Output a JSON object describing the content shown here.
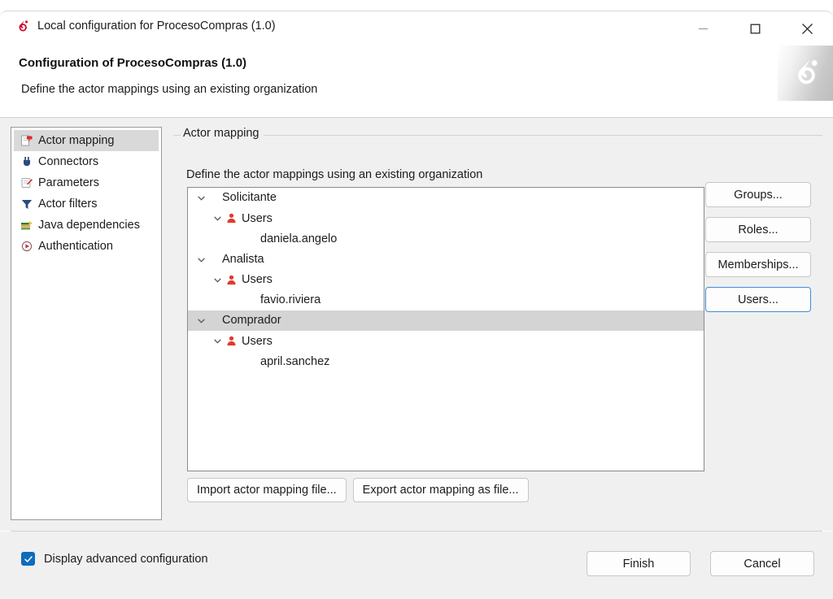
{
  "window": {
    "title": "Local configuration for ProcesoCompras (1.0)",
    "app_icon": "bonita-logo-icon",
    "controls": {
      "minimize": "minimize-icon",
      "maximize": "maximize-icon",
      "close": "close-icon"
    }
  },
  "header": {
    "title": "Configuration of ProcesoCompras (1.0)",
    "description": "Define the actor mappings using an existing organization",
    "watermark_icon": "bonita-logo-watermark"
  },
  "sidebar": {
    "items": [
      {
        "label": "Actor mapping",
        "icon": "actor-mapping-icon",
        "selected": true
      },
      {
        "label": "Connectors",
        "icon": "connector-plug-icon",
        "selected": false
      },
      {
        "label": "Parameters",
        "icon": "parameters-icon",
        "selected": false
      },
      {
        "label": "Actor filters",
        "icon": "filter-funnel-icon",
        "selected": false
      },
      {
        "label": "Java dependencies",
        "icon": "java-books-icon",
        "selected": false
      },
      {
        "label": "Authentication",
        "icon": "authentication-icon",
        "selected": false
      }
    ]
  },
  "main": {
    "group_legend": "Actor mapping",
    "description": "Define the actor mappings using an existing organization",
    "tree": [
      {
        "label": "Solicitante",
        "level": 0,
        "expanded": true,
        "icon": null,
        "selected": false
      },
      {
        "label": "Users",
        "level": 1,
        "expanded": true,
        "icon": "user-icon",
        "selected": false
      },
      {
        "label": "daniela.angelo",
        "level": 2,
        "expanded": null,
        "icon": null,
        "selected": false
      },
      {
        "label": "Analista",
        "level": 0,
        "expanded": true,
        "icon": null,
        "selected": false
      },
      {
        "label": "Users",
        "level": 1,
        "expanded": true,
        "icon": "user-icon",
        "selected": false
      },
      {
        "label": "favio.riviera",
        "level": 2,
        "expanded": null,
        "icon": null,
        "selected": false
      },
      {
        "label": "Comprador",
        "level": 0,
        "expanded": true,
        "icon": null,
        "selected": true
      },
      {
        "label": "Users",
        "level": 1,
        "expanded": true,
        "icon": "user-icon",
        "selected": false
      },
      {
        "label": "april.sanchez",
        "level": 2,
        "expanded": null,
        "icon": null,
        "selected": false
      }
    ],
    "side_buttons": [
      {
        "label": "Groups...",
        "focused": false
      },
      {
        "label": "Roles...",
        "focused": false
      },
      {
        "label": "Memberships...",
        "focused": false
      },
      {
        "label": "Users...",
        "focused": true
      }
    ],
    "io_buttons": [
      {
        "label": "Import actor mapping file..."
      },
      {
        "label": "Export actor mapping as file..."
      }
    ]
  },
  "footer": {
    "advanced_checkbox": {
      "label": "Display advanced configuration",
      "checked": true
    },
    "finish_label": "Finish",
    "cancel_label": "Cancel"
  },
  "colors": {
    "accent": "#0f6cbd",
    "brand_red": "#cf0a2c",
    "focus_border": "#3f8ddb",
    "selection_gray": "#d4d4d4"
  }
}
